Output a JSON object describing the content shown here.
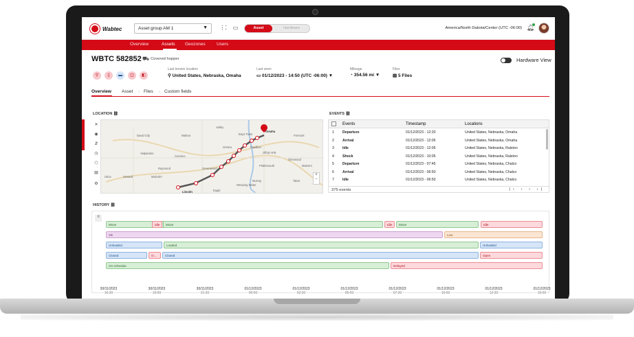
{
  "header": {
    "logo_text": "Wabtec",
    "asset_group": "Asset group AM 1",
    "toggle_asset": "Asset",
    "toggle_hardware": "Hardware",
    "timezone": "America/North Dakota/Center (UTC -06:00)"
  },
  "nav": {
    "items": [
      "Overview",
      "Assets",
      "Geozones",
      "Users"
    ],
    "active": "Assets"
  },
  "asset": {
    "title": "WBTC 582852",
    "type": "Covered hopper",
    "hardware_view_label": "Hardware View",
    "last_location_label": "Last known location",
    "last_location_value": "United States, Nebraska, Omaha",
    "last_seen_label": "Last seen",
    "last_seen_value": "01/12/2023 - 14:50 (UTC -06:00)",
    "mileage_label": "Mileage",
    "mileage_value": "354.56 mi",
    "files_label": "Files",
    "files_value": "5 Files"
  },
  "tabs": [
    "Overview",
    "Asset",
    "Files",
    "Custom fields"
  ],
  "location_label": "LOCATION",
  "events_label": "EVENTS",
  "history_label": "HISTORY",
  "map_labels": [
    "Valley",
    "Boys Town",
    "Omaha",
    "Wahoo",
    "Fremont",
    "Gretna",
    "Papillion",
    "Offutt AFB",
    "Ceresco",
    "Valparaiso",
    "Glenwood",
    "Plattsmouth",
    "Malvern",
    "Raymond",
    "Greenwood",
    "Murray",
    "Utica",
    "Seward",
    "Malcolm",
    "Lincoln",
    "Weeping Water",
    "Tabor",
    "Eagle",
    "David City"
  ],
  "events": {
    "columns": [
      "Events",
      "Timestamp",
      "Locations"
    ],
    "rows": [
      {
        "n": "1",
        "event": "Departure",
        "ts": "01/12/2023 - 12:20",
        "loc": "United States, Nebraska, Omaha"
      },
      {
        "n": "2",
        "event": "Arrival",
        "ts": "01/12/2023 - 12:05",
        "loc": "United States, Nebraska, Omaha"
      },
      {
        "n": "3",
        "event": "Idle",
        "ts": "01/12/2023 - 12:05",
        "loc": "United States, Nebraska, Ralston"
      },
      {
        "n": "4",
        "event": "Shock",
        "ts": "01/12/2023 - 10:05",
        "loc": "United States, Nebraska, Ralston"
      },
      {
        "n": "5",
        "event": "Departure",
        "ts": "01/12/2023 - 07:45",
        "loc": "United States, Nebraska, Chalco"
      },
      {
        "n": "6",
        "event": "Arrival",
        "ts": "01/12/2023 - 06:50",
        "loc": "United States, Nebraska, Chalco"
      },
      {
        "n": "7",
        "event": "Idle",
        "ts": "01/12/2023 - 06:50",
        "loc": "United States, Nebraska, Chalco"
      }
    ],
    "count": "375 events"
  },
  "history": {
    "lanes": [
      [
        {
          "label": "Move",
          "c": "g"
        },
        {
          "label": "Idle",
          "c": "r"
        },
        {
          "label": "Move",
          "c": "g"
        },
        {
          "label": "Idle",
          "c": "r"
        },
        {
          "label": "Move",
          "c": "g"
        },
        {
          "label": "Idle",
          "c": "r"
        }
      ],
      [
        {
          "label": "Ok",
          "c": "p"
        },
        {
          "label": "Low",
          "c": "o"
        }
      ],
      [
        {
          "label": "Unloaded",
          "c": "b"
        },
        {
          "label": "Loaded",
          "c": "g"
        },
        {
          "label": "Unloaded",
          "c": "b"
        }
      ],
      [
        {
          "label": "Closed",
          "c": "b"
        },
        {
          "label": "O...",
          "c": "r"
        },
        {
          "label": "Closed",
          "c": "b"
        },
        {
          "label": "Open",
          "c": "r"
        }
      ],
      [
        {
          "label": "On schedule",
          "c": "g"
        },
        {
          "label": "Delayed",
          "c": "r"
        }
      ]
    ],
    "ticks": [
      {
        "d": "30/11/2023",
        "t": "16:30"
      },
      {
        "d": "30/11/2023",
        "t": "19:00"
      },
      {
        "d": "30/11/2023",
        "t": "21:30"
      },
      {
        "d": "01/12/2023",
        "t": "00:00"
      },
      {
        "d": "01/12/2023",
        "t": "02:30"
      },
      {
        "d": "01/12/2023",
        "t": "05:00"
      },
      {
        "d": "01/12/2023",
        "t": "07:30"
      },
      {
        "d": "01/12/2023",
        "t": "10:00"
      },
      {
        "d": "01/12/2023",
        "t": "12:30"
      },
      {
        "d": "01/12/2023",
        "t": "15:00"
      }
    ]
  },
  "colors": {
    "brand": "#d40a17",
    "move": "#d7eed7",
    "idle": "#fbd9dc"
  }
}
